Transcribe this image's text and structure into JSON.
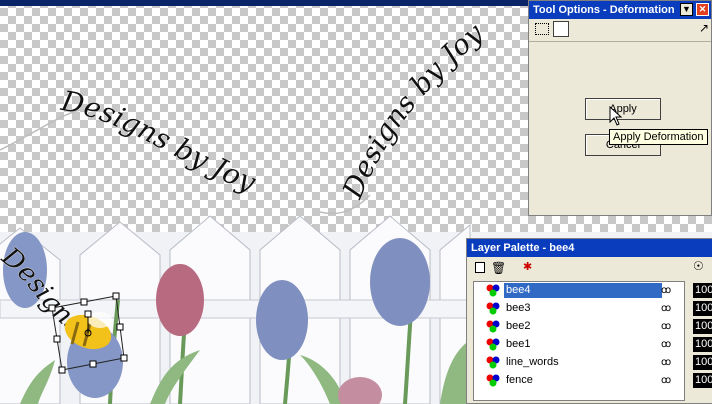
{
  "tool_options": {
    "title": "Tool Options - Deformation",
    "apply_label": "Apply",
    "cancel_label": "Cancel",
    "tooltip": "Apply Deformation"
  },
  "layer_palette": {
    "title": "Layer Palette - bee4",
    "layers": [
      {
        "name": "bee4",
        "selected": true,
        "opacity": "100"
      },
      {
        "name": "bee3",
        "selected": false,
        "opacity": "100"
      },
      {
        "name": "bee2",
        "selected": false,
        "opacity": "100"
      },
      {
        "name": "bee1",
        "selected": false,
        "opacity": "100"
      },
      {
        "name": "line_words",
        "selected": false,
        "opacity": "100"
      },
      {
        "name": "fence",
        "selected": false,
        "opacity": "100"
      }
    ]
  },
  "canvas_text": {
    "phrase1": "Designs by Joy",
    "phrase2": "Designs by Joy",
    "phrase3": "Designs by Joy"
  },
  "colors": {
    "titlebar": "#0a3dbd",
    "selected_row": "#316ac5",
    "tooltip_bg": "#ffffe1",
    "dialog_bg": "#ece9d8"
  }
}
